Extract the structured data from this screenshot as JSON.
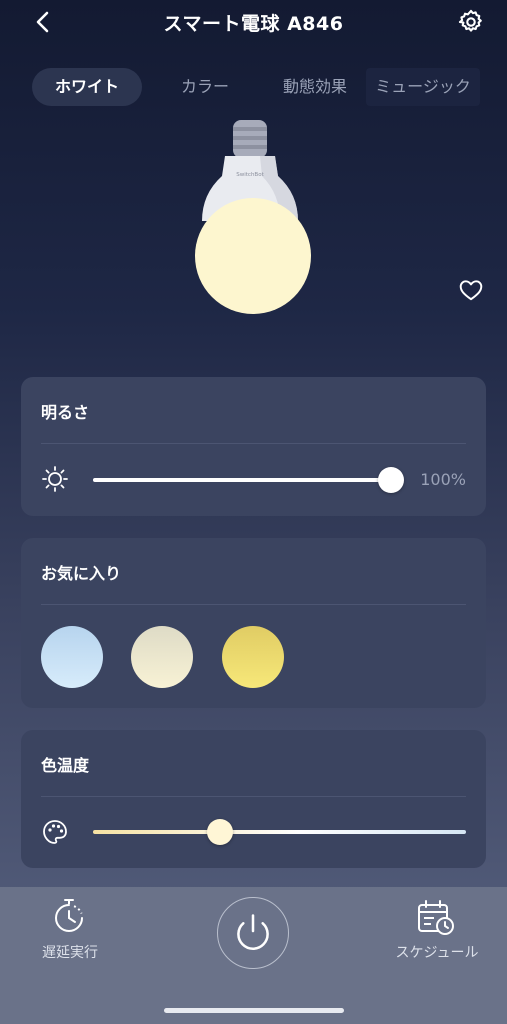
{
  "header": {
    "title": "スマート電球 A846",
    "back_icon": "chevron-left-icon",
    "settings_icon": "gear-icon"
  },
  "tabs": [
    {
      "label": "ホワイト",
      "active": true
    },
    {
      "label": "カラー",
      "active": false
    },
    {
      "label": "動態効果",
      "active": false
    },
    {
      "label": "ミュージック",
      "active": false
    }
  ],
  "bulb": {
    "brand": "SwitchBot",
    "glow_color": "#fdf6cf"
  },
  "brightness": {
    "title": "明るさ",
    "value_text": "100%",
    "level": 1.0,
    "icon": "sun-icon"
  },
  "favorites": {
    "title": "お気に入り",
    "swatches": [
      {
        "color_top": "#b7d4ee",
        "color_bottom": "#d7ecfb"
      },
      {
        "color_top": "#dedbc6",
        "color_bottom": "#f8f2d5"
      },
      {
        "color_top": "#e0cc64",
        "color_bottom": "#f7e879"
      }
    ]
  },
  "color_temp": {
    "title": "色温度",
    "level": 0.34,
    "icon": "palette-icon",
    "warm_color": "#f6e2a3",
    "cool_color": "#d5e6f4"
  },
  "bottom": {
    "timer_label": "遅延実行",
    "schedule_label": "スケジュール",
    "power_icon": "power-icon"
  },
  "colors": {
    "accent": "#ffffff",
    "card": "#3b4460",
    "muted": "#9aa2b7"
  }
}
